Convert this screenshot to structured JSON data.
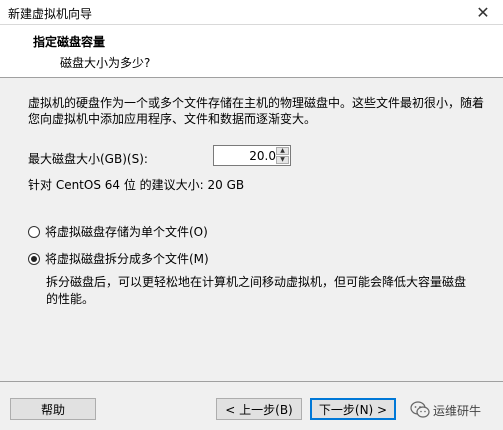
{
  "window": {
    "title": "新建虚拟机向导",
    "close_glyph": "✕"
  },
  "header": {
    "title": "指定磁盘容量",
    "subtitle": "磁盘大小为多少?"
  },
  "content": {
    "description": "虚拟机的硬盘作为一个或多个文件存储在主机的物理磁盘中。这些文件最初很小，随着您向虚拟机中添加应用程序、文件和数据而逐渐变大。",
    "size_label": "最大磁盘大小(GB)(S):",
    "size_value": "20.0",
    "recommendation": "针对 CentOS 64 位 的建议大小: 20 GB",
    "options": [
      {
        "label": "将虚拟磁盘存储为单个文件(O)",
        "selected": false
      },
      {
        "label": "将虚拟磁盘拆分成多个文件(M)",
        "selected": true
      }
    ],
    "split_note": "拆分磁盘后，可以更轻松地在计算机之间移动虚拟机，但可能会降低大容量磁盘的性能。"
  },
  "buttons": {
    "help": "帮助",
    "back": "< 上一步(B)",
    "next": "下一步(N) >"
  },
  "watermark": {
    "text": "运维研牛",
    "icon": "wechat-icon"
  }
}
